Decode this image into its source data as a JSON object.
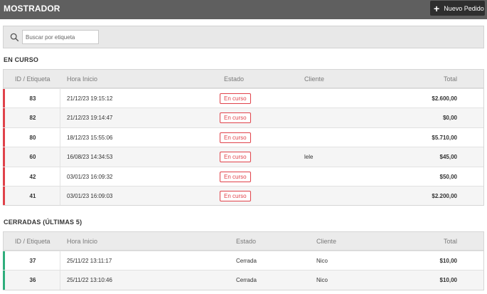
{
  "header": {
    "title": "MOSTRADOR",
    "new_order_label": "Nuevo Pedido"
  },
  "search": {
    "placeholder": "Buscar por etiqueta"
  },
  "colors": {
    "open_accent": "#e0424a",
    "closed_accent": "#2fae7c",
    "topbar": "#5f5f5f"
  },
  "open_section": {
    "title": "EN CURSO",
    "columns": [
      "ID / Etiqueta",
      "Hora Inicio",
      "Estado",
      "Cliente",
      "Total"
    ],
    "rows": [
      {
        "id": "83",
        "start": "21/12/23 19:15:12",
        "status": "En curso",
        "client": "",
        "total": "$2.600,00"
      },
      {
        "id": "82",
        "start": "21/12/23 19:14:47",
        "status": "En curso",
        "client": "",
        "total": "$0,00"
      },
      {
        "id": "80",
        "start": "18/12/23 15:55:06",
        "status": "En curso",
        "client": "",
        "total": "$5.710,00"
      },
      {
        "id": "60",
        "start": "16/08/23 14:34:53",
        "status": "En curso",
        "client": "lele",
        "total": "$45,00"
      },
      {
        "id": "42",
        "start": "03/01/23 16:09:32",
        "status": "En curso",
        "client": "",
        "total": "$50,00"
      },
      {
        "id": "41",
        "start": "03/01/23 16:09:03",
        "status": "En curso",
        "client": "",
        "total": "$2.200,00"
      }
    ]
  },
  "closed_section": {
    "title": "CERRADAS (ÚLTIMAS 5)",
    "columns": [
      "ID / Etiqueta",
      "Hora Inicio",
      "Estado",
      "Cliente",
      "Total"
    ],
    "rows": [
      {
        "id": "37",
        "start": "25/11/22 13:11:17",
        "status": "Cerrada",
        "client": "Nico",
        "total": "$10,00"
      },
      {
        "id": "36",
        "start": "25/11/22 13:10:46",
        "status": "Cerrada",
        "client": "Nico",
        "total": "$10,00"
      }
    ]
  }
}
